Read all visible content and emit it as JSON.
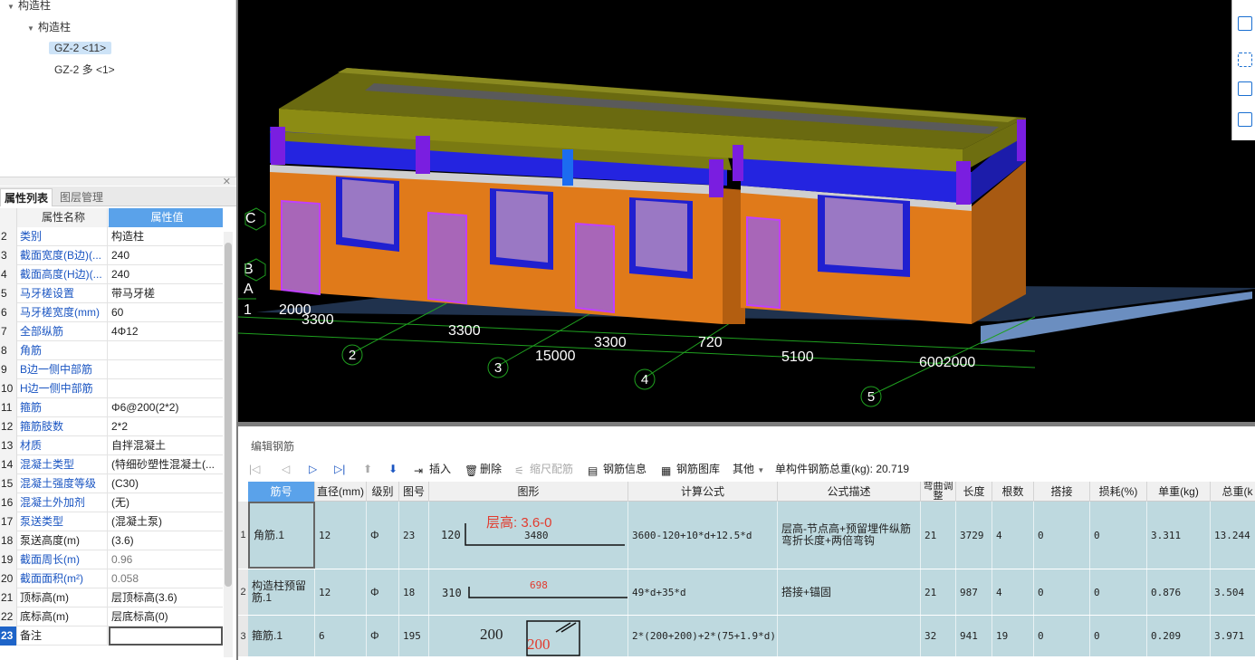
{
  "tree": {
    "root": "构造柱",
    "child": "构造柱",
    "items": [
      "GZ-2 <11>",
      "GZ-2 多 <1>"
    ]
  },
  "props": {
    "tabs": [
      "属性列表",
      "图层管理"
    ],
    "header": {
      "name": "属性名称",
      "value": "属性值"
    },
    "rows": [
      {
        "n": "2",
        "k": "类别",
        "v": "构造柱",
        "blue": true
      },
      {
        "n": "3",
        "k": "截面宽度(B边)(...",
        "v": "240",
        "blue": true
      },
      {
        "n": "4",
        "k": "截面高度(H边)(...",
        "v": "240",
        "blue": true
      },
      {
        "n": "5",
        "k": "马牙槎设置",
        "v": "带马牙槎",
        "blue": true
      },
      {
        "n": "6",
        "k": "马牙槎宽度(mm)",
        "v": "60",
        "blue": true
      },
      {
        "n": "7",
        "k": "全部纵筋",
        "v": "4Φ12",
        "blue": true
      },
      {
        "n": "8",
        "k": "角筋",
        "v": "",
        "blue": true
      },
      {
        "n": "9",
        "k": "B边一侧中部筋",
        "v": "",
        "blue": true
      },
      {
        "n": "10",
        "k": "H边一侧中部筋",
        "v": "",
        "blue": true
      },
      {
        "n": "11",
        "k": "箍筋",
        "v": "Φ6@200(2*2)",
        "blue": true
      },
      {
        "n": "12",
        "k": "箍筋肢数",
        "v": "2*2",
        "blue": true
      },
      {
        "n": "13",
        "k": "材质",
        "v": "自拌混凝土",
        "blue": true
      },
      {
        "n": "14",
        "k": "混凝土类型",
        "v": "(特细砂塑性混凝土(...",
        "blue": true
      },
      {
        "n": "15",
        "k": "混凝土强度等级",
        "v": "(C30)",
        "blue": true
      },
      {
        "n": "16",
        "k": "混凝土外加剂",
        "v": "(无)",
        "blue": true
      },
      {
        "n": "17",
        "k": "泵送类型",
        "v": "(混凝土泵)",
        "blue": true
      },
      {
        "n": "18",
        "k": "泵送高度(m)",
        "v": "(3.6)",
        "blue": false
      },
      {
        "n": "19",
        "k": "截面周长(m)",
        "v": "0.96",
        "blue": true,
        "gray": true
      },
      {
        "n": "20",
        "k": "截面面积(m²)",
        "v": "0.058",
        "blue": true,
        "gray": true
      },
      {
        "n": "21",
        "k": "顶标高(m)",
        "v": "层顶标高(3.6)",
        "blue": false
      },
      {
        "n": "22",
        "k": "底标高(m)",
        "v": "层底标高(0)",
        "blue": false
      },
      {
        "n": "23",
        "k": "备注",
        "v": "",
        "blue": false,
        "selected": true
      }
    ]
  },
  "viewport": {
    "axis_labels_left": [
      "C",
      "B",
      "A",
      "1"
    ],
    "dims": [
      "2000",
      "3300",
      "3300",
      "3300",
      "720",
      "15000",
      "5100",
      "6002000"
    ],
    "axis_numbers": [
      "2",
      "3",
      "4",
      "5"
    ]
  },
  "editor": {
    "title": "编辑钢筋",
    "toolbar": {
      "insert": "插入",
      "delete": "删除",
      "scale": "缩尺配筋",
      "info": "钢筋信息",
      "library": "钢筋图库",
      "other": "其他",
      "total_label": "单构件钢筋总重(kg): 20.719"
    },
    "columns": [
      "筋号",
      "直径(mm)",
      "级别",
      "图号",
      "图形",
      "计算公式",
      "公式描述",
      "弯曲调整",
      "长度",
      "根数",
      "搭接",
      "损耗(%)",
      "单重(kg)",
      "总重(k"
    ],
    "rows": [
      {
        "rn": "1",
        "name": "角筋.1",
        "dia": "12",
        "grade": "Φ",
        "fig": "23",
        "shape_left": "120",
        "shape_len": "3480",
        "shape_note": "层高: 3.6-0",
        "formula": "3600-120+10*d+12.5*d",
        "desc": "层高-节点高+预留埋件纵筋弯折长度+两倍弯钩",
        "bend": "21",
        "length": "3729",
        "count": "4",
        "lap": "0",
        "loss": "0",
        "unit": "3.311",
        "total": "13.244"
      },
      {
        "rn": "2",
        "name": "构造柱预留筋.1",
        "dia": "12",
        "grade": "Φ",
        "fig": "18",
        "shape_left": "310",
        "shape_len": "698",
        "shape_note": "",
        "formula": "49*d+35*d",
        "desc": "搭接+锚固",
        "bend": "21",
        "length": "987",
        "count": "4",
        "lap": "0",
        "loss": "0",
        "unit": "0.876",
        "total": "3.504"
      },
      {
        "rn": "3",
        "name": "箍筋.1",
        "dia": "6",
        "grade": "Φ",
        "fig": "195",
        "shape_left": "200",
        "shape_len": "200",
        "shape_note": "",
        "formula": "2*(200+200)+2*(75+1.9*d)",
        "desc": "",
        "bend": "32",
        "length": "941",
        "count": "19",
        "lap": "0",
        "loss": "0",
        "unit": "0.209",
        "total": "3.971"
      }
    ]
  }
}
